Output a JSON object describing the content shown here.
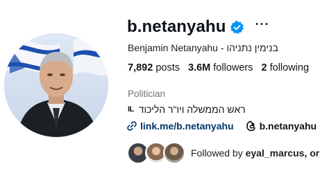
{
  "profile": {
    "username": "b.netanyahu",
    "full_name": "Benjamin Netanyahu - בנימין נתניהו",
    "more_label": "···",
    "verified_color": "#0095f6"
  },
  "stats": {
    "posts_count": "7,892",
    "posts_label": "posts",
    "followers_count": "3.6M",
    "followers_label": "followers",
    "following_count": "2",
    "following_label": "following"
  },
  "bio": {
    "category": "Politician",
    "flag_text": "IL",
    "text": "ראש הממשלה ויו\"ר הליכוד"
  },
  "links": {
    "website": "link.me/b.netanyahu",
    "threads": "b.netanyahu"
  },
  "followed_by": {
    "prefix": "Followed by",
    "names": "eyal_marcus, or_c"
  },
  "icons": {
    "verified": "verified-badge-icon",
    "more": "more-options-icon",
    "link": "link-icon",
    "threads": "threads-icon"
  },
  "colors": {
    "link_text": "#00376b",
    "category_text": "#737373",
    "flag_blue": "#1d4fb0"
  }
}
